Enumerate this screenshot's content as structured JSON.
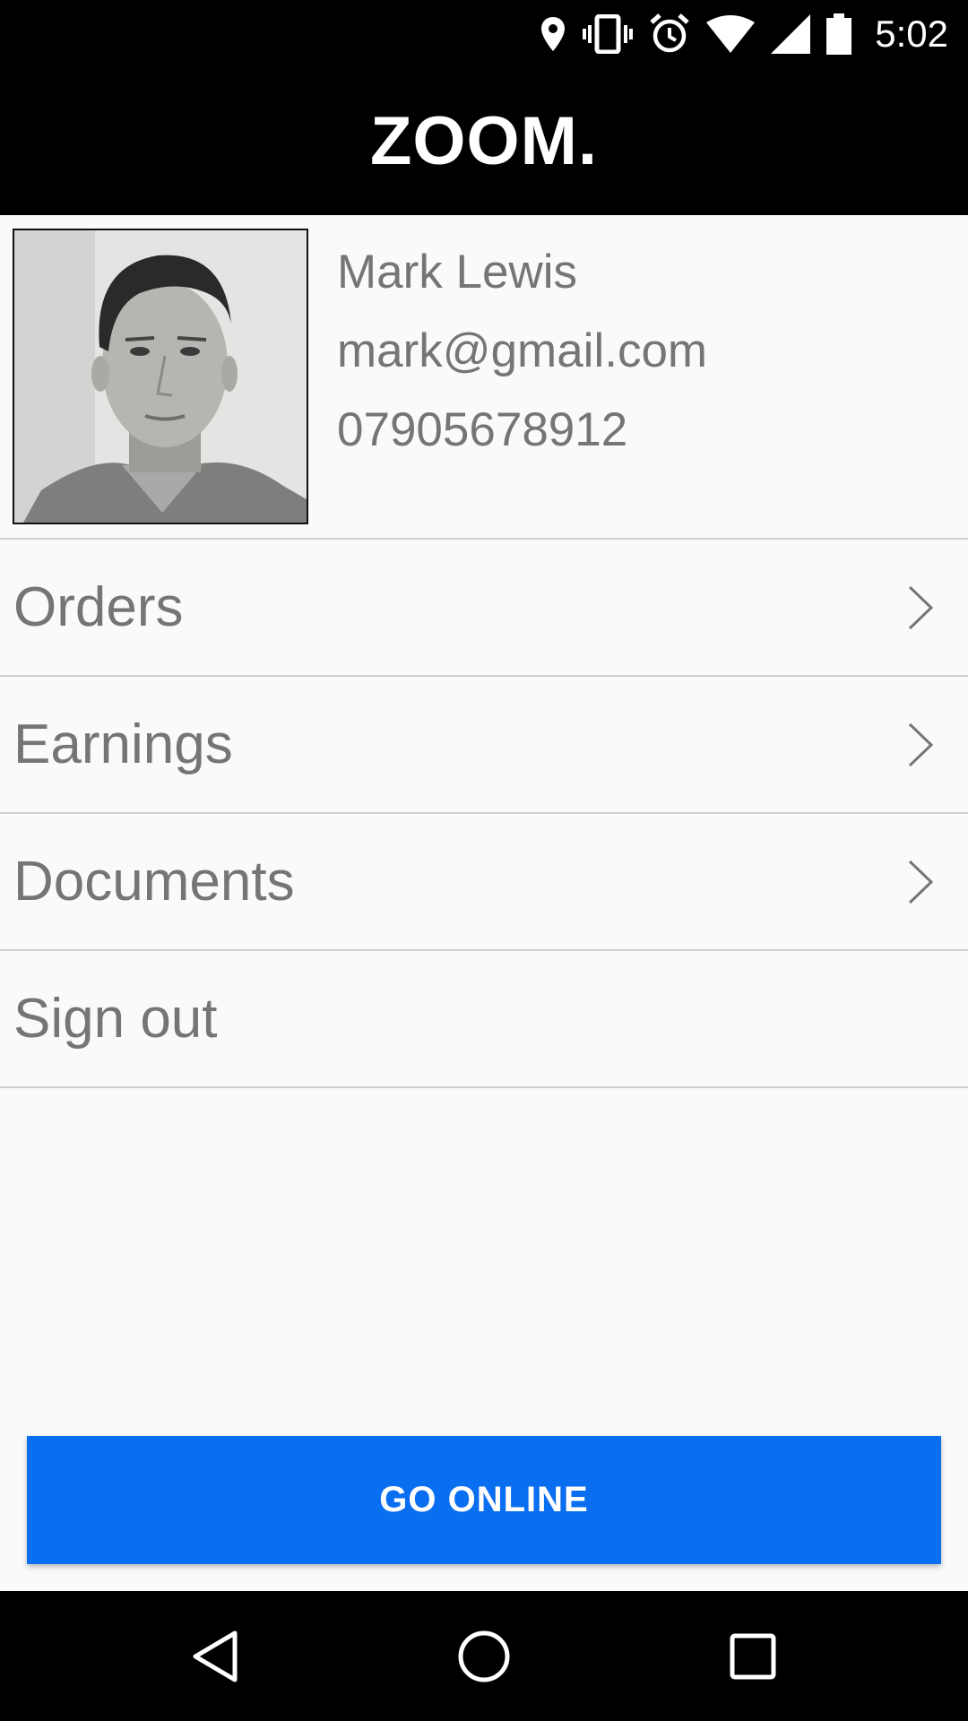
{
  "status_bar": {
    "time": "5:02",
    "icons": [
      "location-icon",
      "vibrate-icon",
      "alarm-icon",
      "wifi-icon",
      "signal-icon",
      "battery-icon"
    ]
  },
  "app_bar": {
    "title": "ZOOM."
  },
  "profile": {
    "name": "Mark Lewis",
    "email": "mark@gmail.com",
    "phone": "07905678912"
  },
  "menu": {
    "items": [
      {
        "label": "Orders",
        "has_chevron": true
      },
      {
        "label": "Earnings",
        "has_chevron": true
      },
      {
        "label": "Documents",
        "has_chevron": true
      },
      {
        "label": "Sign out",
        "has_chevron": false
      }
    ]
  },
  "action": {
    "go_online_label": "GO ONLINE"
  },
  "colors": {
    "primary": "#0a6ef0",
    "header": "#000000",
    "text_secondary": "#757575",
    "background": "#fafafa"
  },
  "nav_bar": {
    "icons": [
      "back-icon",
      "home-icon",
      "recents-icon"
    ]
  }
}
